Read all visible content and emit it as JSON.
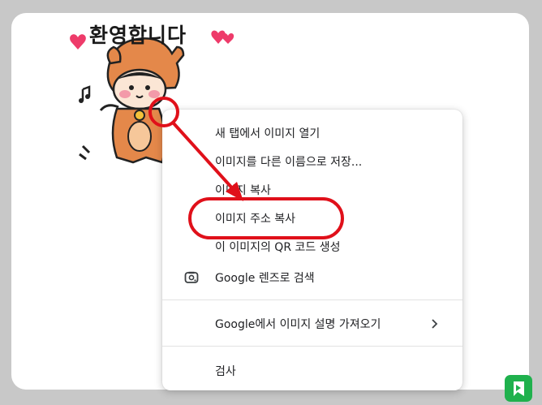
{
  "sticker": {
    "title": "환영합니다"
  },
  "context_menu": {
    "items": [
      {
        "label": "새 탭에서 이미지 열기"
      },
      {
        "label": "이미지를 다른 이름으로 저장..."
      },
      {
        "label": "이미지 복사"
      },
      {
        "label": "이미지 주소 복사"
      },
      {
        "label": "이 이미지의 QR 코드 생성"
      },
      {
        "label": "Google 렌즈로 검색",
        "icon": "lens-icon"
      },
      {
        "label": "Google에서 이미지 설명 가져오기",
        "icon": "chevron-right-icon"
      },
      {
        "label": "검사"
      }
    ]
  },
  "colors": {
    "annotation": "#e0101a",
    "menu_text": "#202124",
    "background": "#c8c8c8",
    "logo": "#1fb14d"
  }
}
